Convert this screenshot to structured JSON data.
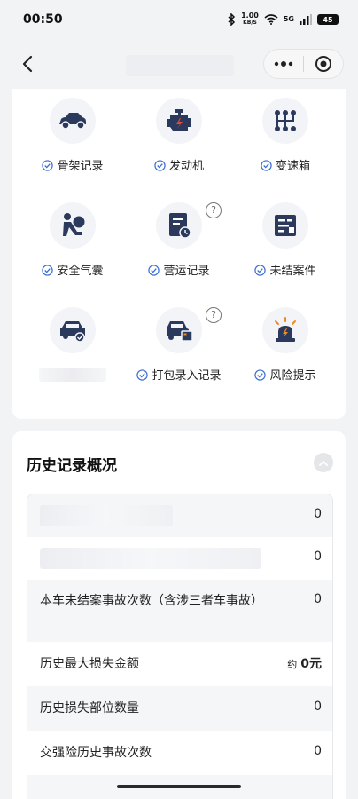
{
  "status_bar": {
    "time": "00:50",
    "bluetooth_icon": "bluetooth-icon",
    "speed_top": "1.00",
    "speed_unit": "KB/S",
    "wifi_icon": "wifi-icon",
    "signal_label": "5G",
    "signal_icon": "signal-icon",
    "battery": "45"
  },
  "nav": {
    "back_icon": "chevron-left-icon",
    "more_icon": "more-dots-icon",
    "close_icon": "target-circle-icon"
  },
  "features": [
    {
      "label": "骨架记录",
      "icon": "car-frame-icon",
      "help": false
    },
    {
      "label": "发动机",
      "icon": "engine-icon",
      "help": false
    },
    {
      "label": "变速箱",
      "icon": "gearbox-icon",
      "help": false
    },
    {
      "label": "安全气囊",
      "icon": "airbag-icon",
      "help": false
    },
    {
      "label": "营运记录",
      "icon": "document-clock-icon",
      "help": true
    },
    {
      "label": "未结案件",
      "icon": "case-file-icon",
      "help": false
    },
    {
      "label": "",
      "icon": "car-check-icon",
      "help": false
    },
    {
      "label": "打包录入记录",
      "icon": "car-package-icon",
      "help": true
    },
    {
      "label": "风险提示",
      "icon": "alarm-light-icon",
      "help": false
    }
  ],
  "help_mark": "?",
  "history": {
    "title": "历史记录概况",
    "rows": [
      {
        "label": "",
        "value": "0"
      },
      {
        "label": "",
        "value": "0"
      },
      {
        "label": "本车未结案事故次数（含涉三者车事故）",
        "value": "0"
      },
      {
        "label": "历史最大损失金额",
        "value_prefix": "约",
        "value": "0元"
      },
      {
        "label": "历史损失部位数量",
        "value": "0"
      },
      {
        "label": "交强险历史事故次数",
        "value": "0"
      }
    ]
  },
  "colors": {
    "icon_navy": "#2b3a5c",
    "check_blue": "#3b6fd6",
    "accent_red": "#e04a3a",
    "accent_orange": "#f08a24"
  }
}
